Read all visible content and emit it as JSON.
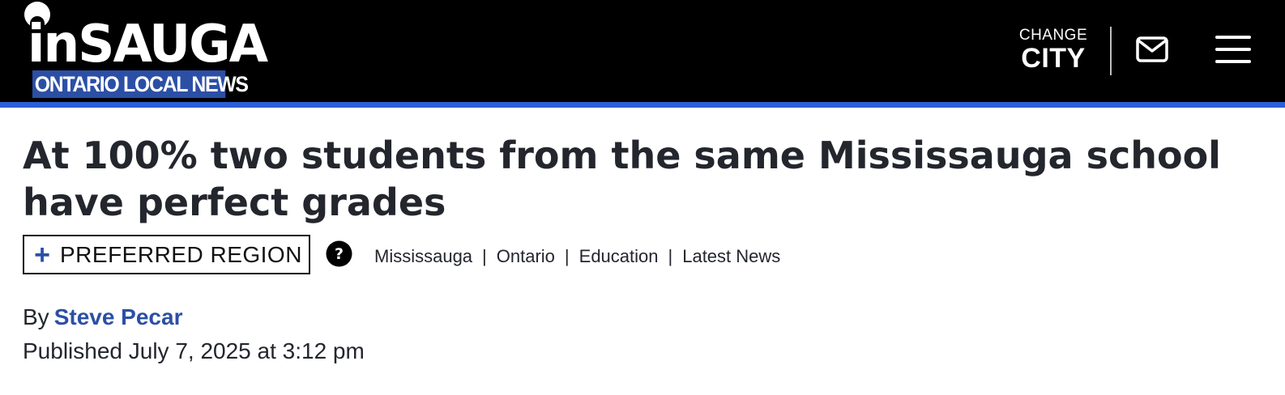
{
  "header": {
    "logo": {
      "wordmark": "inSAUGA",
      "tagline": "ONTARIO LOCAL NEWS"
    },
    "change_city": {
      "top": "CHANGE",
      "bottom": "CITY"
    },
    "icons": [
      "mail-icon",
      "hamburger-menu-icon"
    ]
  },
  "article": {
    "headline": "At 100% two students from the same Mississauga school have perfect grades",
    "preferred_region_button": "PREFERRED REGION",
    "categories": [
      "Mississauga",
      "Ontario",
      "Education",
      "Latest News"
    ],
    "category_separator": "|",
    "byline_prefix": "By",
    "author": "Steve Pecar",
    "published": "Published July 7, 2025 at 3:12 pm"
  },
  "colors": {
    "header_bg": "#000000",
    "accent": "#2b5fd8",
    "brand_blue": "#2c4fa6",
    "text": "#23262d"
  }
}
